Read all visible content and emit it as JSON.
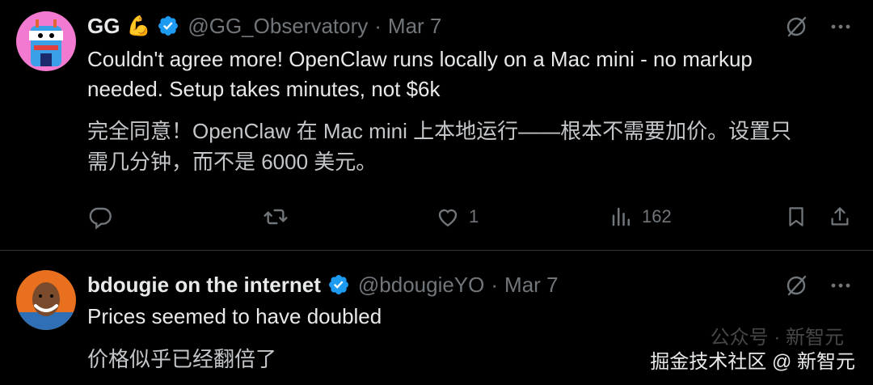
{
  "tweets": [
    {
      "name": "GG",
      "name_emoji": "💪",
      "handle": "@GG_Observatory",
      "separator": "·",
      "date": "Mar 7",
      "text_line1": "Couldn't agree more! OpenClaw runs locally on a Mac mini - no markup",
      "text_line2": "needed. Setup takes minutes, not $6k",
      "translation_line1": "完全同意！OpenClaw 在 Mac mini 上本地运行——根本不需要加价。设置只",
      "translation_line2": "需几分钟，而不是 6000 美元。",
      "likes": "1",
      "views": "162"
    },
    {
      "name": "bdougie on the internet",
      "handle": "@bdougieYO",
      "separator": "·",
      "date": "Mar 7",
      "text": "Prices seemed to have doubled",
      "translation": "价格似乎已经翻倍了"
    }
  ],
  "watermark": {
    "faint_text": "公众号 · 新智元",
    "text": "掘金技术社区 @ 新智元"
  },
  "colors": {
    "background": "#000000",
    "text": "#e7e9ea",
    "muted": "#71767b",
    "verified": "#1d9bf0",
    "divider": "#2f3336"
  },
  "icons": [
    "grok-icon",
    "more-icon",
    "reply-icon",
    "retweet-icon",
    "like-icon",
    "views-icon",
    "bookmark-icon",
    "share-icon",
    "verified-badge-icon"
  ]
}
